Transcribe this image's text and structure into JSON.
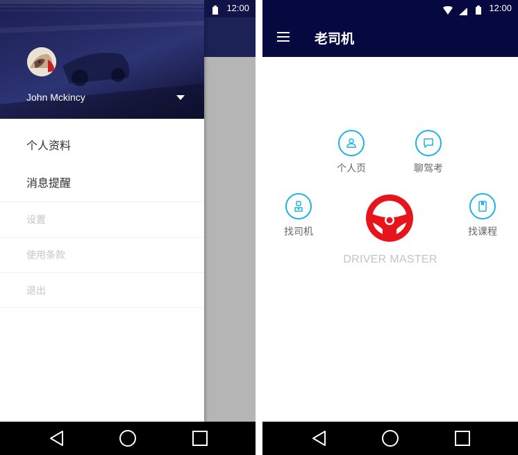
{
  "status_bar": {
    "time": "12:00"
  },
  "drawer": {
    "user_name": "John Mckincy",
    "primary_items": [
      {
        "label": "个人资料"
      },
      {
        "label": "消息提醒"
      }
    ],
    "secondary_items": [
      {
        "label": "设置"
      },
      {
        "label": "使用条款"
      },
      {
        "label": "退出"
      }
    ]
  },
  "home": {
    "app_title": "老司机",
    "features": [
      {
        "label": "个人页",
        "icon": "person-icon"
      },
      {
        "label": "聊驾考",
        "icon": "chat-bubble-icon"
      },
      {
        "label": "找司机",
        "icon": "driver-icon"
      },
      {
        "label": "找课程",
        "icon": "book-icon"
      }
    ],
    "brand_text": "DRIVER MASTER"
  },
  "nav_bar": {
    "icons": [
      "back-triangle-icon",
      "home-circle-icon",
      "recents-square-icon"
    ]
  },
  "colors": {
    "status_bar": "#06093f",
    "app_bar": "#06093f",
    "accent_blue": "#19b3e6",
    "logo_red": "#e8141b",
    "nav_bar": "#000000"
  }
}
